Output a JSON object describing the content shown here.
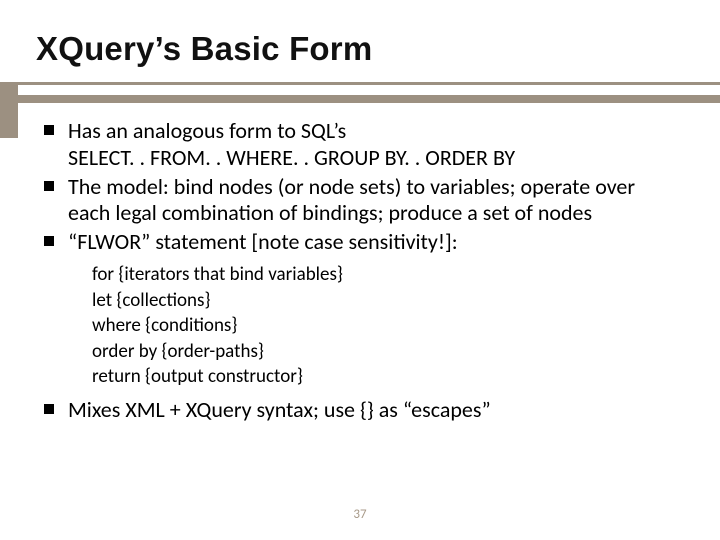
{
  "slide": {
    "title": "XQuery’s Basic Form",
    "page_number": "37"
  },
  "bullets": {
    "b0_line1": "Has an analogous form to SQL’s",
    "b0_line2": "SELECT. . FROM. . WHERE. . GROUP BY. . ORDER BY",
    "b1": "The model:  bind nodes (or node sets) to variables; operate over each legal combination of bindings; produce a set of nodes",
    "b2": "“FLWOR” statement [note case sensitivity!]:",
    "b3": "Mixes XML + XQuery syntax; use {} as “escapes”"
  },
  "flwor": {
    "l0": "for {iterators that bind variables}",
    "l1": "let {collections}",
    "l2": "where {conditions}",
    "l3": "order by {order-paths}",
    "l4": "return {output constructor}"
  }
}
